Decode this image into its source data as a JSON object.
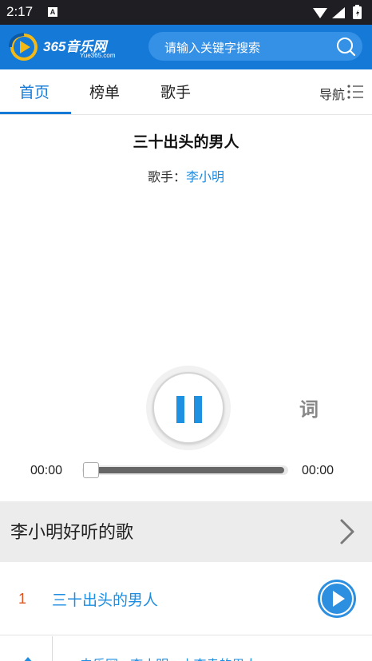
{
  "status_bar": {
    "time": "2:17",
    "notification_badge": "A",
    "icons": [
      "wifi-icon",
      "signal-icon",
      "battery-icon"
    ]
  },
  "header": {
    "logo_text": "365音乐网",
    "logo_subtext": "Yue365.com",
    "search_placeholder": "请输入关键字搜索",
    "search_icon": "search-icon",
    "brand_color": "#1479d7"
  },
  "nav": {
    "tabs": [
      {
        "label": "首页",
        "active": true
      },
      {
        "label": "榜单",
        "active": false
      },
      {
        "label": "歌手",
        "active": false
      }
    ],
    "menu_label": "导航",
    "menu_icon": "list-menu-icon"
  },
  "player": {
    "song_title": "三十出头的男人",
    "singer_prefix": "歌手：",
    "singer_name": "李小明",
    "state": "playing",
    "lyric_button": "词",
    "current_time": "00:00",
    "total_time": "00:00",
    "progress": 0.01
  },
  "section": {
    "title": "李小明好听的歌",
    "chevron_icon": "chevron-right-icon"
  },
  "songs": [
    {
      "index": "1",
      "title": "三十出头的男人",
      "play_icon": "play-circle-icon"
    }
  ],
  "bottom_bar": {
    "text": "去乐网 · 李小明 · 小李幸的男人",
    "up_icon": "arrow-up-icon"
  },
  "colors": {
    "accent": "#1c8de0",
    "index_color": "#e0521e",
    "section_bg": "#ececec"
  }
}
